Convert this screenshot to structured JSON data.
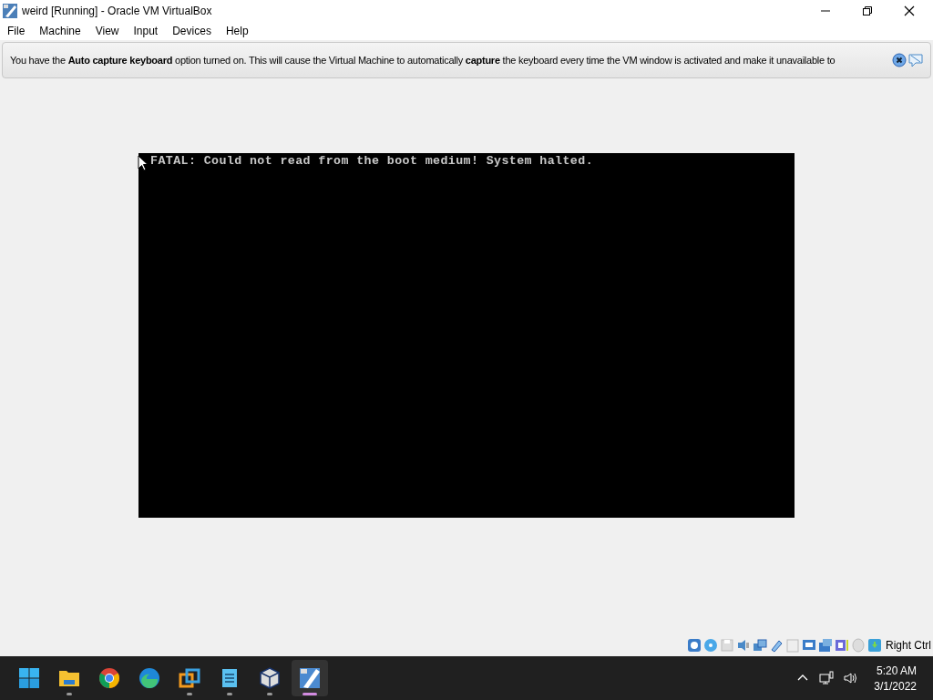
{
  "window": {
    "title": "weird [Running] - Oracle VM VirtualBox"
  },
  "menu": [
    "File",
    "Machine",
    "View",
    "Input",
    "Devices",
    "Help"
  ],
  "banner": {
    "message": "You have the **Auto capture keyboard** option turned on. This will cause the Virtual Machine to automatically **capture** the keyboard every time the VM window is activated and make it unavailable to"
  },
  "vm_screen": {
    "text": "FATAL: Could not read from the boot medium! System halted."
  },
  "status_bar": {
    "host_key": "Right Ctrl"
  },
  "taskbar": {
    "apps": [
      {
        "kind": "start",
        "running": false,
        "selected": false
      },
      {
        "kind": "folder",
        "running": true,
        "selected": false
      },
      {
        "kind": "chrome",
        "running": false,
        "selected": false
      },
      {
        "kind": "edge",
        "running": false,
        "selected": false
      },
      {
        "kind": "vmware",
        "running": true,
        "selected": false
      },
      {
        "kind": "notepad",
        "running": true,
        "selected": false
      },
      {
        "kind": "virtualbox",
        "running": true,
        "selected": false
      },
      {
        "kind": "vm",
        "running": true,
        "selected": true
      }
    ],
    "time": "5:20 AM",
    "date": "3/1/2022"
  }
}
